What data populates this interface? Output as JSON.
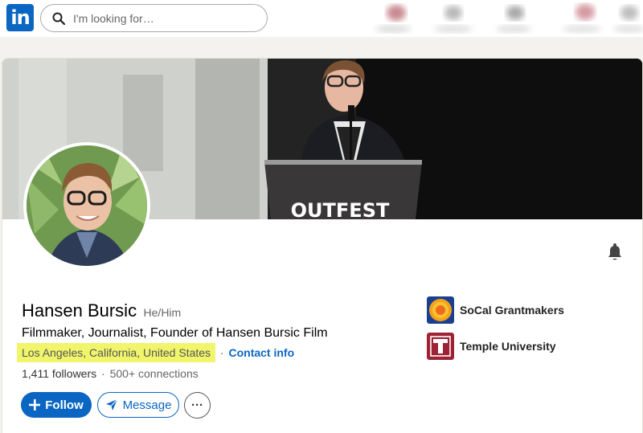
{
  "nav": {
    "logo_text": "in",
    "search_placeholder": "I'm looking for…"
  },
  "banner": {
    "podium_text": "OUTFEST"
  },
  "profile": {
    "name": "Hansen Bursic",
    "pronouns": "He/Him",
    "headline": "Filmmaker, Journalist, Founder of Hansen Bursic Film",
    "location": "Los Angeles, California, United States",
    "separator": "·",
    "contact_info": "Contact info",
    "followers": "1,411 followers",
    "connections": "500+ connections"
  },
  "actions": {
    "follow_label": "Follow",
    "message_label": "Message",
    "more_label": "···"
  },
  "organizations": [
    {
      "name": "SoCal Grantmakers",
      "icon": "sun-logo-icon"
    },
    {
      "name": "Temple University",
      "icon": "temple-t-logo-icon"
    }
  ],
  "colors": {
    "brand": "#0a66c2",
    "highlight": "#f0f56b",
    "temple_red": "#9d2235"
  }
}
